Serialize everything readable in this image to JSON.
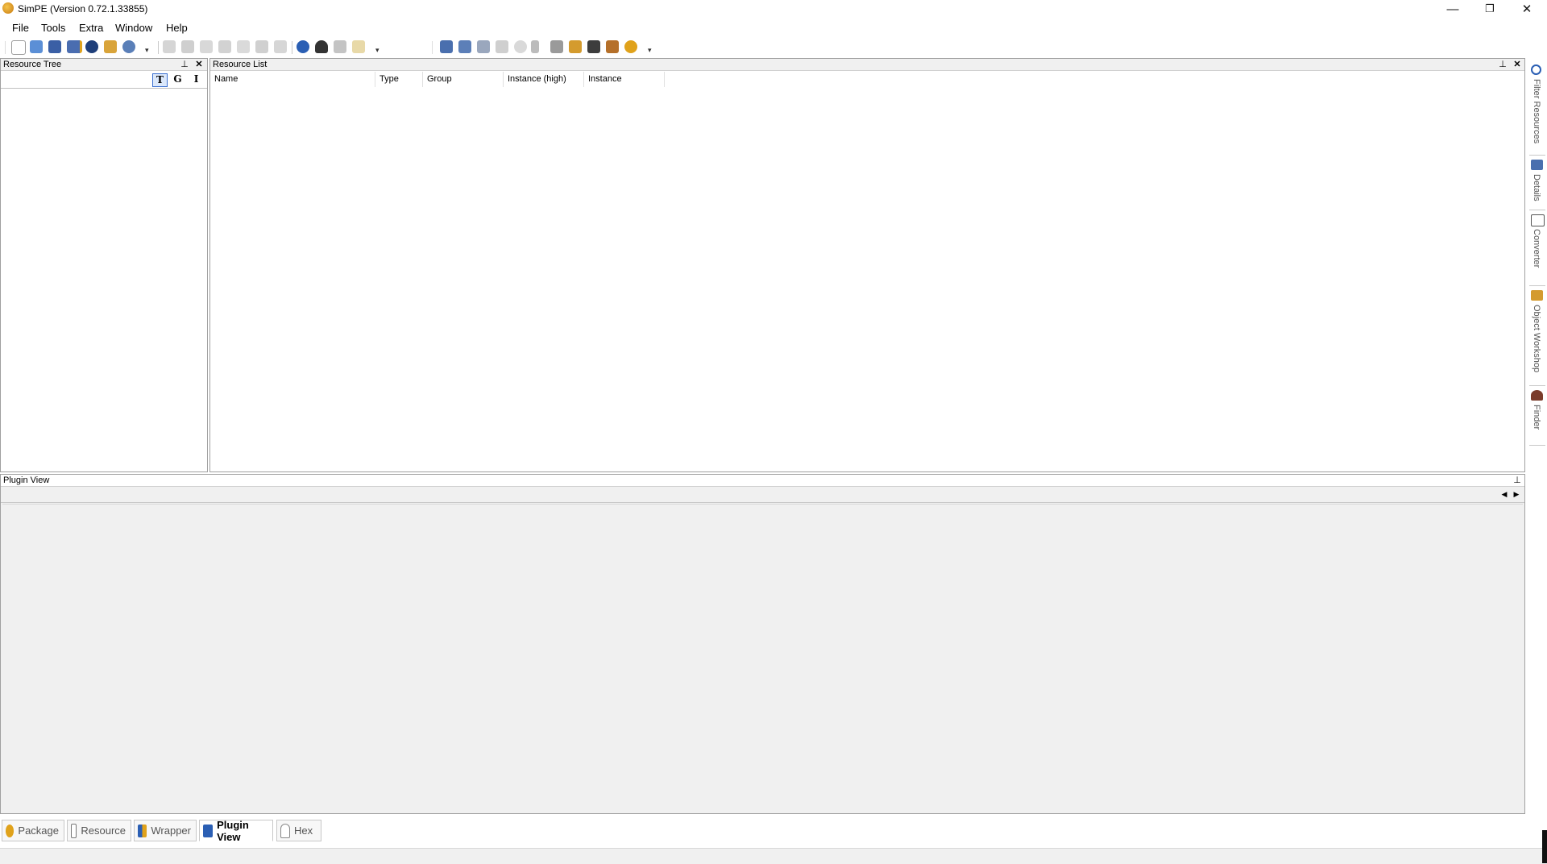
{
  "window": {
    "title": "SimPE (Version 0.72.1.33855)",
    "minimize": "—",
    "restore": "❐",
    "close": "✕"
  },
  "menu": [
    "File",
    "Tools",
    "Extra",
    "Window",
    "Help"
  ],
  "panes": {
    "resource_tree": {
      "title": "Resource Tree",
      "pin": "⊥",
      "close": "✕",
      "buttons": [
        "T",
        "G",
        "I"
      ]
    },
    "resource_list": {
      "title": "Resource List",
      "pin": "⊥",
      "close": "✕",
      "columns": [
        "Name",
        "Type",
        "Group",
        "Instance (high)",
        "Instance"
      ]
    },
    "plugin_view": {
      "title": "Plugin View",
      "pin": "⊥",
      "prev": "◀",
      "next": "▶"
    }
  },
  "sidebar": [
    {
      "label": "Filter Resources",
      "icon": "magnifier-icon"
    },
    {
      "label": "Details",
      "icon": "details-icon"
    },
    {
      "label": "Converter",
      "icon": "converter-icon"
    },
    {
      "label": "Object Workshop",
      "icon": "workshop-icon"
    },
    {
      "label": "Finder",
      "icon": "binoculars-icon"
    }
  ],
  "bottom_tabs": [
    {
      "label": "Package",
      "icon": "package-icon",
      "active": false
    },
    {
      "label": "Resource",
      "icon": "resource-icon",
      "active": false
    },
    {
      "label": "Wrapper",
      "icon": "wrapper-icon",
      "active": false
    },
    {
      "label": "Plugin View",
      "icon": "plugin-view-icon",
      "active": true
    },
    {
      "label": "Hex",
      "icon": "hex-icon",
      "active": false
    }
  ],
  "colors": {
    "accent": "#e0a21b",
    "blue": "#2b5fb4",
    "pane_bg": "#f0f0f0"
  }
}
